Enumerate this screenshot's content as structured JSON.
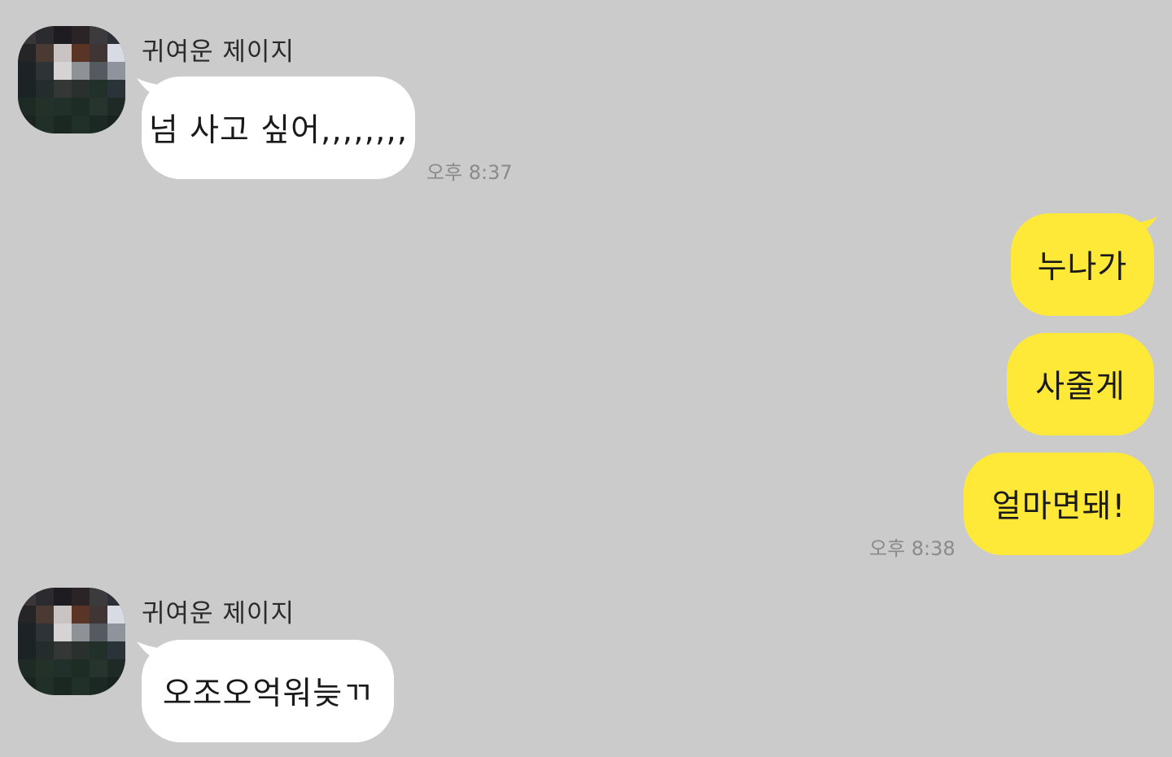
{
  "chat": {
    "messages": [
      {
        "sender": "귀여운 제이지",
        "text": "넘 사고 싶어,,,,,,,,",
        "time": "오후 8:37"
      },
      {
        "text_1": "누나가",
        "text_2": "사줄게",
        "text_3": "얼마면돼!",
        "time": "오후 8:38"
      },
      {
        "sender": "귀여운 제이지",
        "text": "오조오억워늦ㄲ"
      }
    ]
  },
  "colors": {
    "background": "#cbcbcb",
    "incoming_bubble": "#ffffff",
    "outgoing_bubble": "#fee838",
    "timestamp": "#8a8a8a"
  },
  "icons": {
    "avatar": "pixelated-profile-photo"
  }
}
